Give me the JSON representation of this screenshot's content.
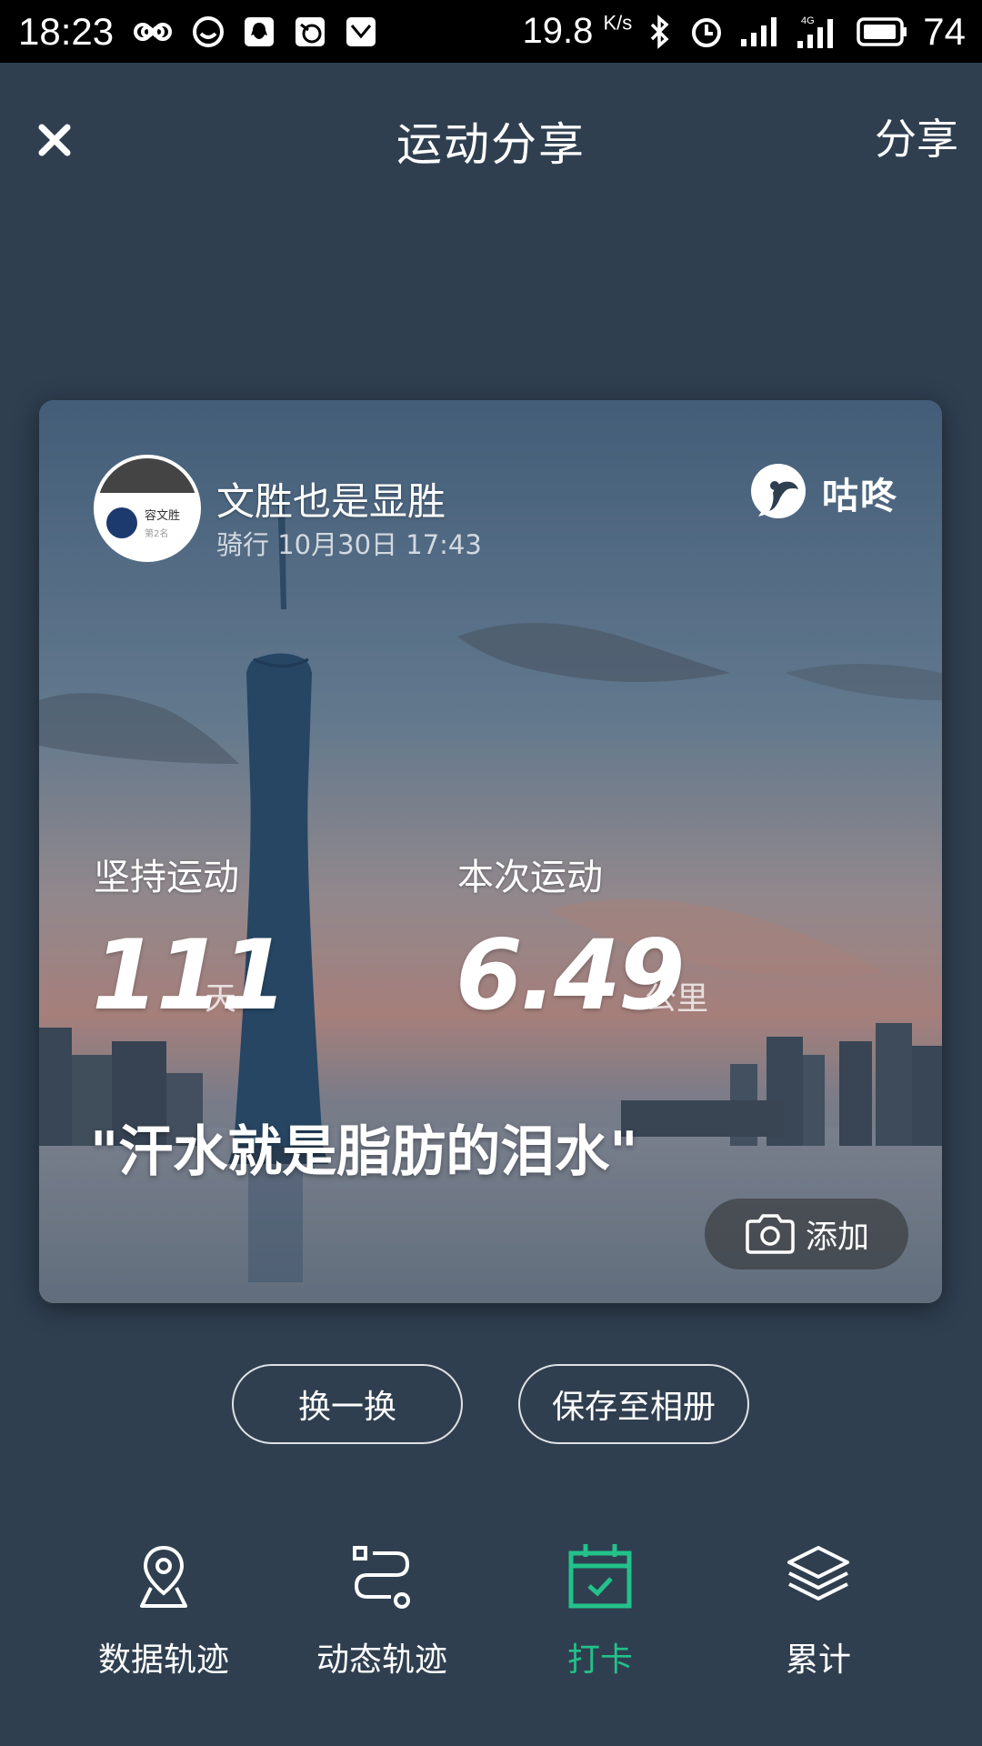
{
  "status_bar": {
    "time": "18:23",
    "net_speed": "19.8",
    "net_speed_unit": "K/s",
    "battery": "74"
  },
  "header": {
    "title": "运动分享",
    "share_label": "分享"
  },
  "card": {
    "user_name": "文胜也是显胜",
    "activity_meta": "骑行 10月30日 17:43",
    "avatar_text": "容文胜",
    "avatar_sub": "第2名",
    "brand_name": "咕咚",
    "stats": {
      "streak_label": "坚持运动",
      "streak_value": "111",
      "streak_unit": "天",
      "session_label": "本次运动",
      "session_value": "6.49",
      "session_unit": "公里"
    },
    "quote": "\"汗水就是脂肪的泪水\"",
    "add_photo_label": "添加"
  },
  "actions": {
    "shuffle_label": "换一换",
    "save_label": "保存至相册"
  },
  "bottom_nav": {
    "items": [
      {
        "label": "数据轨迹",
        "icon": "map-pin-icon",
        "active": false
      },
      {
        "label": "动态轨迹",
        "icon": "route-icon",
        "active": false
      },
      {
        "label": "打卡",
        "icon": "calendar-check-icon",
        "active": true
      },
      {
        "label": "累计",
        "icon": "layers-icon",
        "active": false
      }
    ]
  },
  "colors": {
    "background": "#2f3f50",
    "accent": "#22c28a",
    "status_bar": "#000000"
  }
}
